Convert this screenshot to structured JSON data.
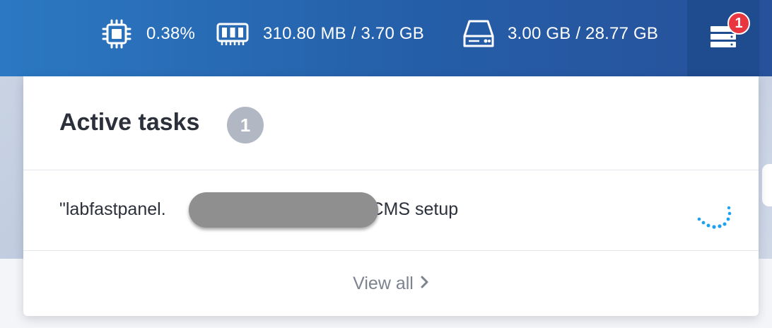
{
  "topbar": {
    "cpu": {
      "icon": "cpu-icon",
      "value": "0.38%"
    },
    "ram": {
      "icon": "memory-icon",
      "value": "310.80 MB / 3.70 GB"
    },
    "disk": {
      "icon": "hard-drive-icon",
      "value": "3.00 GB / 28.77 GB"
    },
    "tasks_button": {
      "icon": "server-stack-icon",
      "badge": "1"
    }
  },
  "panel": {
    "title": "Active tasks",
    "count": "1",
    "tasks": [
      {
        "label_prefix": "\"labfastpanel.",
        "label_suffix": "\" CMS setup",
        "status_icon": "spinner-icon"
      }
    ],
    "view_all": "View all"
  },
  "colors": {
    "topbar_gradient_start": "#2c78c2",
    "topbar_gradient_end": "#27519a",
    "badge": "#e8353f",
    "count_circle": "#b2b8c3",
    "spinner": "#1da1f2"
  }
}
